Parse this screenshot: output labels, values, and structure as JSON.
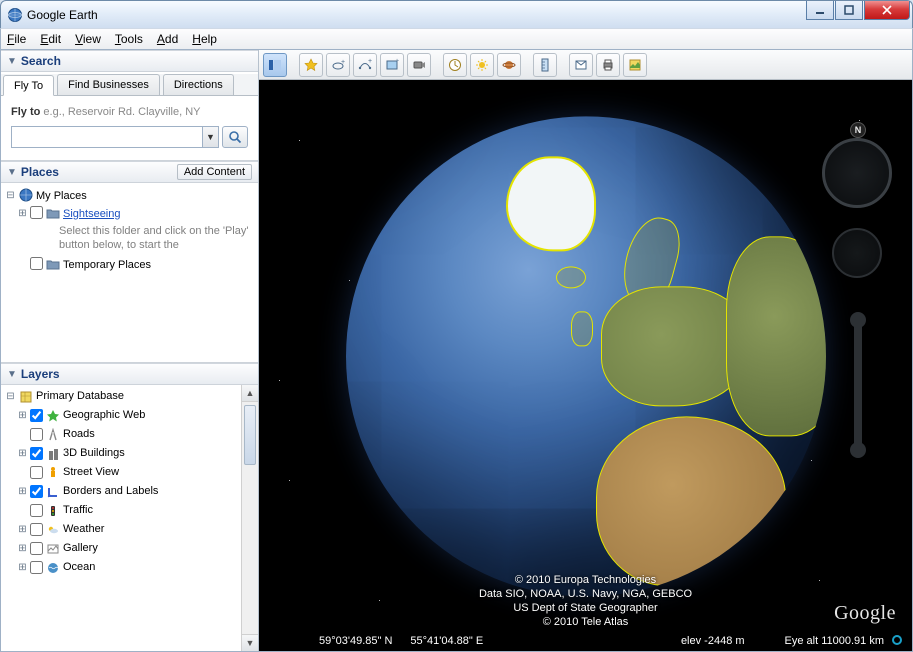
{
  "window": {
    "title": "Google Earth"
  },
  "menu": {
    "file": "File",
    "edit": "Edit",
    "view": "View",
    "tools": "Tools",
    "add": "Add",
    "help": "Help"
  },
  "sidebar": {
    "search": {
      "title": "Search",
      "tabs": {
        "flyto": "Fly To",
        "findbiz": "Find Businesses",
        "directions": "Directions"
      },
      "flyto_label": "Fly to",
      "flyto_hint": " e.g., Reservoir Rd. Clayville, NY",
      "input_value": ""
    },
    "places": {
      "title": "Places",
      "add_content": "Add Content",
      "my_places": "My Places",
      "sightseeing": "Sightseeing",
      "sightseeing_hint": "Select this folder and click on the 'Play' button below, to start the",
      "temporary": "Temporary Places"
    },
    "layers": {
      "title": "Layers",
      "primary": "Primary Database",
      "items": [
        {
          "label": "Geographic Web",
          "checked": true,
          "expand": true,
          "icon": "star",
          "color": "#3fb23f"
        },
        {
          "label": "Roads",
          "checked": false,
          "expand": false,
          "icon": "roads",
          "color": "#888"
        },
        {
          "label": "3D Buildings",
          "checked": true,
          "expand": true,
          "icon": "buildings",
          "color": "#7a7a7a"
        },
        {
          "label": "Street View",
          "checked": false,
          "expand": false,
          "icon": "pegman",
          "color": "#f0a000"
        },
        {
          "label": "Borders and Labels",
          "checked": true,
          "expand": true,
          "icon": "borders",
          "color": "#3a5fd0"
        },
        {
          "label": "Traffic",
          "checked": false,
          "expand": false,
          "icon": "traffic",
          "color": "#f0b000"
        },
        {
          "label": "Weather",
          "checked": false,
          "expand": true,
          "icon": "weather",
          "color": "#3a7fd0"
        },
        {
          "label": "Gallery",
          "checked": false,
          "expand": true,
          "icon": "gallery",
          "color": "#888"
        },
        {
          "label": "Ocean",
          "checked": false,
          "expand": true,
          "icon": "ocean",
          "color": "#4a90c8"
        }
      ]
    }
  },
  "nav_compass": "N",
  "attr": {
    "l1": "© 2010 Europa Technologies",
    "l2": "Data SIO, NOAA, U.S. Navy, NGA, GEBCO",
    "l3": "US Dept of State Geographer",
    "l4": "© 2010 Tele Atlas"
  },
  "google": "Google",
  "status": {
    "lat": "59°03'49.85\" N",
    "lon": "55°41'04.88\" E",
    "elev": "elev -2448 m",
    "eye": "Eye alt 11000.91 km"
  }
}
